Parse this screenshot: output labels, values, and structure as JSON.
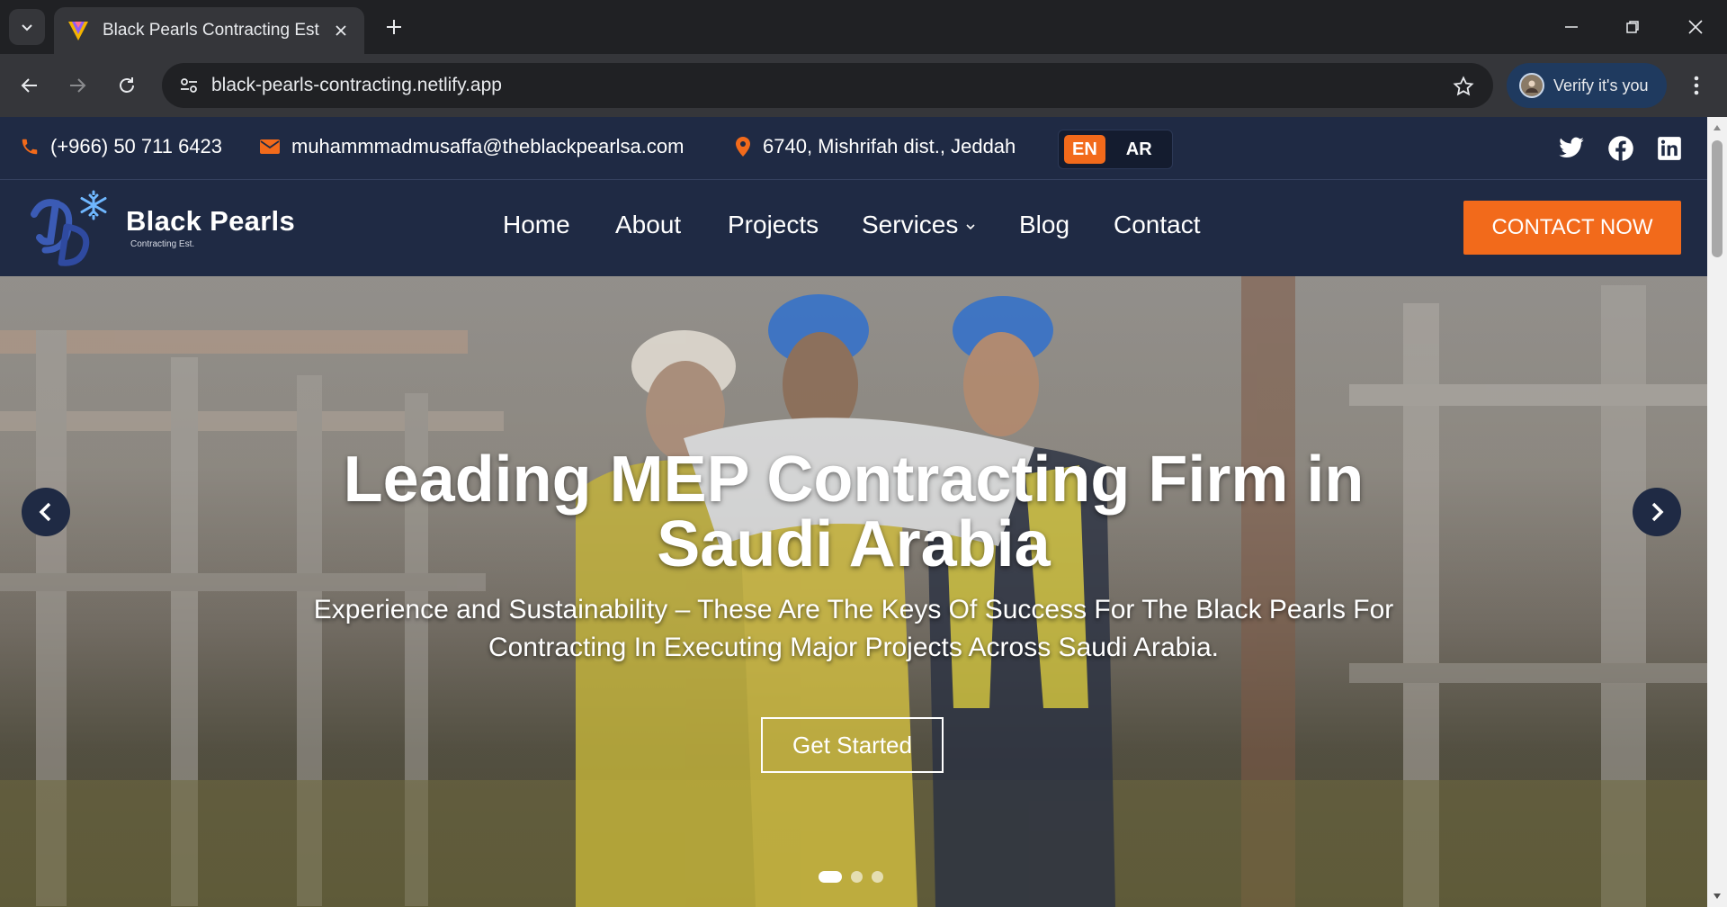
{
  "browser": {
    "tab_title": "Black Pearls Contracting Est",
    "url": "black-pearls-contracting.netlify.app",
    "verify_label": "Verify it's you"
  },
  "topbar": {
    "phone": "(+966) 50 711 6423",
    "email": "muhammmadmusaffa@theblackpearlsa.com",
    "address": "6740, Mishrifah dist., Jeddah",
    "languages": [
      "EN",
      "AR"
    ],
    "active_language": "EN",
    "social_icons": [
      "twitter-icon",
      "facebook-icon",
      "linkedin-icon"
    ]
  },
  "brand": {
    "name": "Black Pearls",
    "subtitle": "Contracting Est."
  },
  "nav": {
    "items": [
      "Home",
      "About",
      "Projects",
      "Services",
      "Blog",
      "Contact"
    ],
    "cta": "CONTACT NOW"
  },
  "hero": {
    "title_line1": "Leading MEP Contracting Firm in",
    "title_line2": "Saudi Arabia",
    "subtitle_line1": "Experience and Sustainability – These Are The Keys Of Success For The Black Pearls For",
    "subtitle_line2": "Contracting In Executing Major Projects Across Saudi Arabia.",
    "button": "Get Started",
    "slide_count": 3,
    "active_slide": 1
  },
  "colors": {
    "navy": "#1f2a44",
    "accent_orange": "#f26a1b",
    "chrome_dark": "#202124",
    "chrome_toolbar": "#35363a"
  }
}
